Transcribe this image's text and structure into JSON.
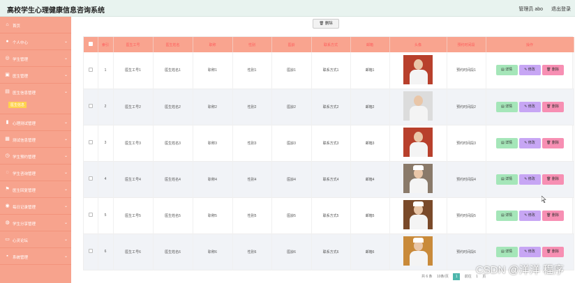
{
  "app": {
    "title": "高校学生心理健康信息咨询系统",
    "admin_label": "管理员",
    "admin_name": "abo",
    "logout_label": "退出登录"
  },
  "sidebar": {
    "items": [
      {
        "label": "首页",
        "icon": "home-icon",
        "glyph": "⌂",
        "arrow": ""
      },
      {
        "label": "个人中心",
        "icon": "user-icon",
        "glyph": "●",
        "arrow": "⌄"
      },
      {
        "label": "学生管理",
        "icon": "student-icon",
        "glyph": "◎",
        "arrow": "⌄"
      },
      {
        "label": "医生管理",
        "icon": "doctor-icon",
        "glyph": "▣",
        "arrow": "⌄"
      },
      {
        "label": "医生信息管理",
        "icon": "doctor-info-icon",
        "glyph": "▤",
        "arrow": "⌄",
        "expanded": true,
        "sub_label": "医生信息"
      },
      {
        "label": "心理测试管理",
        "icon": "chart-icon",
        "glyph": "▮",
        "arrow": "⌄"
      },
      {
        "label": "测试信息管理",
        "icon": "clipboard-icon",
        "glyph": "▦",
        "arrow": "⌄"
      },
      {
        "label": "学生预约管理",
        "icon": "calendar-icon",
        "glyph": "◷",
        "arrow": "⌄"
      },
      {
        "label": "学生咨询管理",
        "icon": "chat-icon",
        "glyph": "◌",
        "arrow": "⌄"
      },
      {
        "label": "医生回复管理",
        "icon": "flag-icon",
        "glyph": "⚑",
        "arrow": "⌄"
      },
      {
        "label": "每日记录管理",
        "icon": "record-icon",
        "glyph": "◉",
        "arrow": "⌄"
      },
      {
        "label": "学生分享管理",
        "icon": "share-icon",
        "glyph": "◍",
        "arrow": "⌄"
      },
      {
        "label": "心灵论坛",
        "icon": "forum-icon",
        "glyph": "▭",
        "arrow": "⌄"
      },
      {
        "label": "系统管理",
        "icon": "settings-icon",
        "glyph": "▪",
        "arrow": "⌄"
      }
    ]
  },
  "toolbar": {
    "delete_label": "删除",
    "delete_icon": "trash-icon"
  },
  "table": {
    "headers": [
      "索引",
      "医生工号",
      "医生姓名",
      "职称",
      "性别",
      "医龄",
      "联系方式",
      "邮箱",
      "头像",
      "预约时间段",
      "操作"
    ],
    "rows": [
      {
        "index": "1",
        "id": "医生工号1",
        "name": "医生姓名1",
        "title": "职称1",
        "gender": "性别1",
        "years": "医龄1",
        "phone": "联系方式1",
        "email": "邮箱1",
        "slot": "预约时间段1",
        "photo_bg": "#b8402c",
        "photo_hat": false
      },
      {
        "index": "2",
        "id": "医生工号2",
        "name": "医生姓名2",
        "title": "职称2",
        "gender": "性别2",
        "years": "医龄2",
        "phone": "联系方式2",
        "email": "邮箱2",
        "slot": "预约时间段2",
        "photo_bg": "#dcdcdc",
        "photo_hat": false
      },
      {
        "index": "3",
        "id": "医生工号3",
        "name": "医生姓名3",
        "title": "职称3",
        "gender": "性别3",
        "years": "医龄3",
        "phone": "联系方式3",
        "email": "邮箱3",
        "slot": "预约时间段3",
        "photo_bg": "#b8402c",
        "photo_hat": false
      },
      {
        "index": "4",
        "id": "医生工号4",
        "name": "医生姓名4",
        "title": "职称4",
        "gender": "性别4",
        "years": "医龄4",
        "phone": "联系方式4",
        "email": "邮箱4",
        "slot": "预约时间段4",
        "photo_bg": "#8a7a6a",
        "photo_hat": true
      },
      {
        "index": "5",
        "id": "医生工号5",
        "name": "医生姓名5",
        "title": "职称5",
        "gender": "性别5",
        "years": "医龄5",
        "phone": "联系方式5",
        "email": "邮箱5",
        "slot": "预约时间段5",
        "photo_bg": "#7a4a2a",
        "photo_hat": true
      },
      {
        "index": "6",
        "id": "医生工号6",
        "name": "医生姓名6",
        "title": "职称6",
        "gender": "性别6",
        "years": "医龄6",
        "phone": "联系方式6",
        "email": "邮箱6",
        "slot": "预约时间段6",
        "photo_bg": "#c98a3a",
        "photo_hat": true
      }
    ],
    "actions": {
      "detail": "详情",
      "edit": "修改",
      "delete": "删除"
    }
  },
  "pagination": {
    "total": "共 6 条",
    "page_size": "10条/页",
    "current": "1",
    "goto": "前往",
    "page_num": "1",
    "page_unit": "页"
  },
  "watermark": "CSDN @洋洋 程序",
  "colors": {
    "sidebar": "#f7a38d",
    "header_row": "#f9a48f",
    "header_text": "#ff5a5a",
    "detail_button": "#a5e6b9",
    "edit_button": "#c7a6f4",
    "delete_button": "#f78fb3",
    "active_submenu": "#ffd34d"
  }
}
